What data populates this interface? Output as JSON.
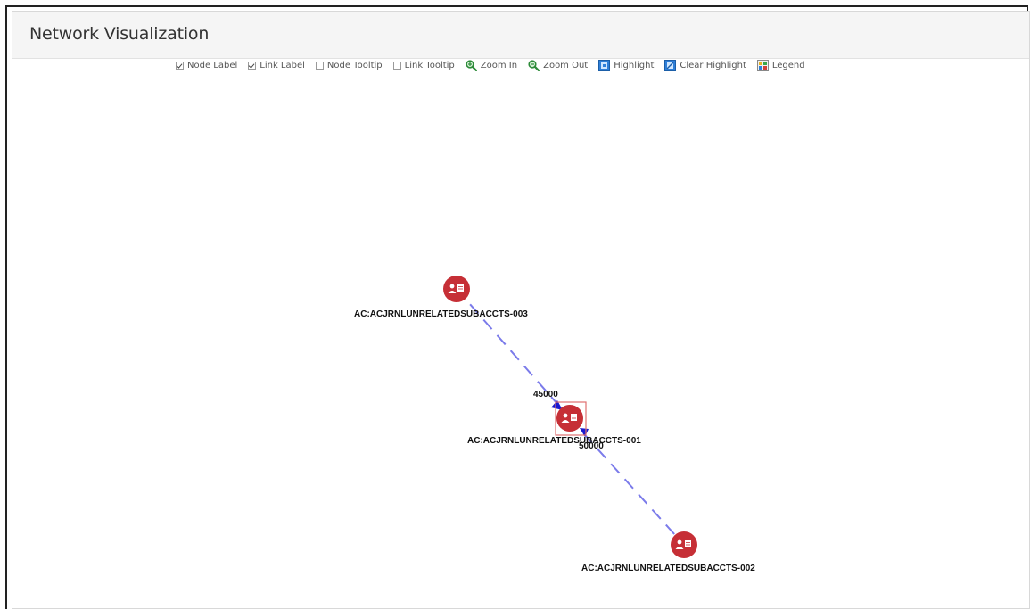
{
  "panel": {
    "title": "Network Visualization"
  },
  "toolbar": {
    "items": [
      {
        "label": "Node Label",
        "kind": "checkbox",
        "checked": true
      },
      {
        "label": "Link Label",
        "kind": "checkbox",
        "checked": true
      },
      {
        "label": "Node Tooltip",
        "kind": "checkbox",
        "checked": false
      },
      {
        "label": "Link Tooltip",
        "kind": "checkbox",
        "checked": false
      },
      {
        "label": "Zoom In",
        "kind": "button",
        "icon": "zoom-in-icon"
      },
      {
        "label": "Zoom Out",
        "kind": "button",
        "icon": "zoom-out-icon"
      },
      {
        "label": "Highlight",
        "kind": "button",
        "icon": "highlight-icon"
      },
      {
        "label": "Clear Highlight",
        "kind": "button",
        "icon": "clear-highlight-icon"
      },
      {
        "label": "Legend",
        "kind": "button",
        "icon": "legend-icon"
      }
    ]
  },
  "graph": {
    "nodes": [
      {
        "id": "n3",
        "label": "AC:ACJRNLUNRELATEDSUBACCTS-003",
        "icon": "account-icon",
        "selected": false
      },
      {
        "id": "n1",
        "label": "AC:ACJRNLUNRELATEDSUBACCTS-001",
        "icon": "account-icon",
        "selected": true
      },
      {
        "id": "n2",
        "label": "AC:ACJRNLUNRELATEDSUBACCTS-002",
        "icon": "account-icon",
        "selected": false
      }
    ],
    "links": [
      {
        "from": "n3",
        "to": "n1",
        "label": "45000"
      },
      {
        "from": "n1",
        "to": "n2",
        "label": "50000"
      }
    ]
  },
  "colors": {
    "node": "#c62f36",
    "link": "#7b7bea",
    "selection": "#e07070"
  }
}
